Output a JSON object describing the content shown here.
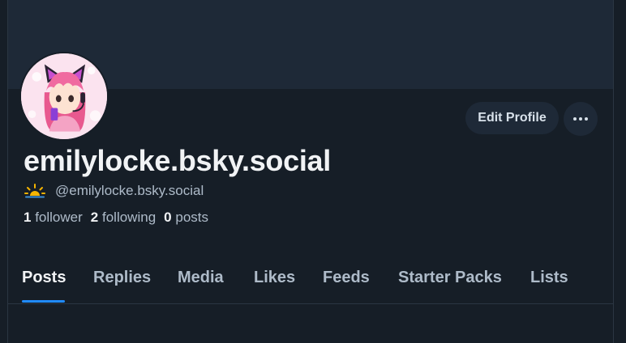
{
  "profile": {
    "display_name": "emilylocke.bsky.social",
    "handle": "@emilylocke.bsky.social",
    "avatar_icon": "anime-catgirl-avatar",
    "handle_icon": "sunrise-icon"
  },
  "actions": {
    "edit_label": "Edit Profile",
    "more_icon": "ellipsis-icon"
  },
  "stats": {
    "followers_count": "1",
    "followers_label": "follower",
    "following_count": "2",
    "following_label": "following",
    "posts_count": "0",
    "posts_label": "posts"
  },
  "tabs": [
    {
      "label": "Posts",
      "active": true
    },
    {
      "label": "Replies",
      "active": false
    },
    {
      "label": "Media",
      "active": false
    },
    {
      "label": "Likes",
      "active": false
    },
    {
      "label": "Feeds",
      "active": false
    },
    {
      "label": "Starter Packs",
      "active": false
    },
    {
      "label": "Lists",
      "active": false
    }
  ],
  "colors": {
    "background": "#161e27",
    "banner": "#1e2937",
    "accent": "#208bfe",
    "text_primary": "#f1f3f5",
    "text_secondary": "#aebbc9"
  }
}
